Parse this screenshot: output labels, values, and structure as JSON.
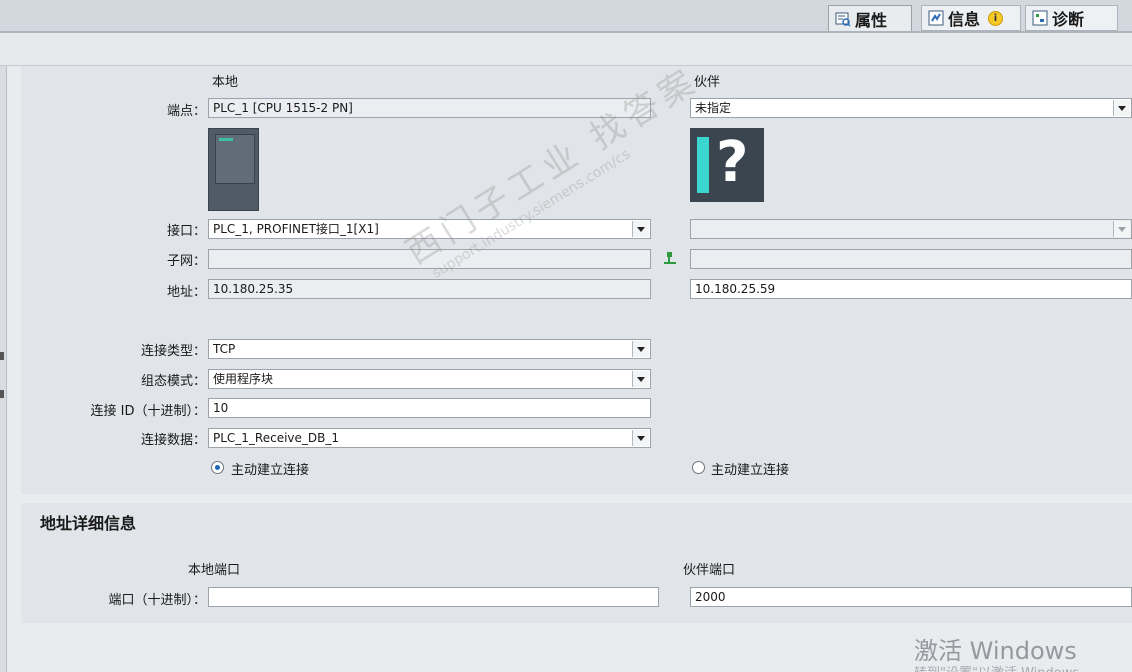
{
  "tabs": [
    {
      "label": "属性",
      "icon": "properties-icon"
    },
    {
      "label": "信息",
      "icon": "info-icon"
    },
    {
      "label": "诊断",
      "icon": "diagnostics-icon"
    }
  ],
  "connection": {
    "local_header": "本地",
    "partner_header": "伙伴",
    "endpoint_label": "端点",
    "endpoint_local": "PLC_1 [CPU 1515-2 PN]",
    "endpoint_partner": "未指定",
    "partner_unknown_symbol": "?",
    "interface_label": "接口",
    "interface_local": "PLC_1, PROFINET接口_1[X1]",
    "interface_partner": "",
    "subnet_label": "子网",
    "subnet_local": "",
    "subnet_partner": "",
    "address_label": "地址",
    "address_local": "10.180.25.35",
    "address_partner": "10.180.25.59",
    "type_label": "连接类型",
    "type_value": "TCP",
    "config_mode_label": "组态模式",
    "config_mode_value": "使用程序块",
    "id_label": "连接 ID（十进制）",
    "id_value": "10",
    "data_label": "连接数据",
    "data_value": "PLC_1_Receive_DB_1",
    "local_active_label": "主动建立连接",
    "local_active": true,
    "partner_active_label": "主动建立连接",
    "partner_active": false,
    "colon": "："
  },
  "address_details": {
    "title": "地址详细信息",
    "local_port_header": "本地端口",
    "partner_port_header": "伙伴端口",
    "port_label": "端口（十进制）",
    "local_port": "",
    "partner_port": "2000"
  },
  "watermark": {
    "line1": "西门子工业 找答案",
    "line2": "support.industry.siemens.com/cs"
  },
  "os_watermark": {
    "title": "激活 Windows",
    "subtitle": "转到\"设置\"以激活 Windows。"
  }
}
